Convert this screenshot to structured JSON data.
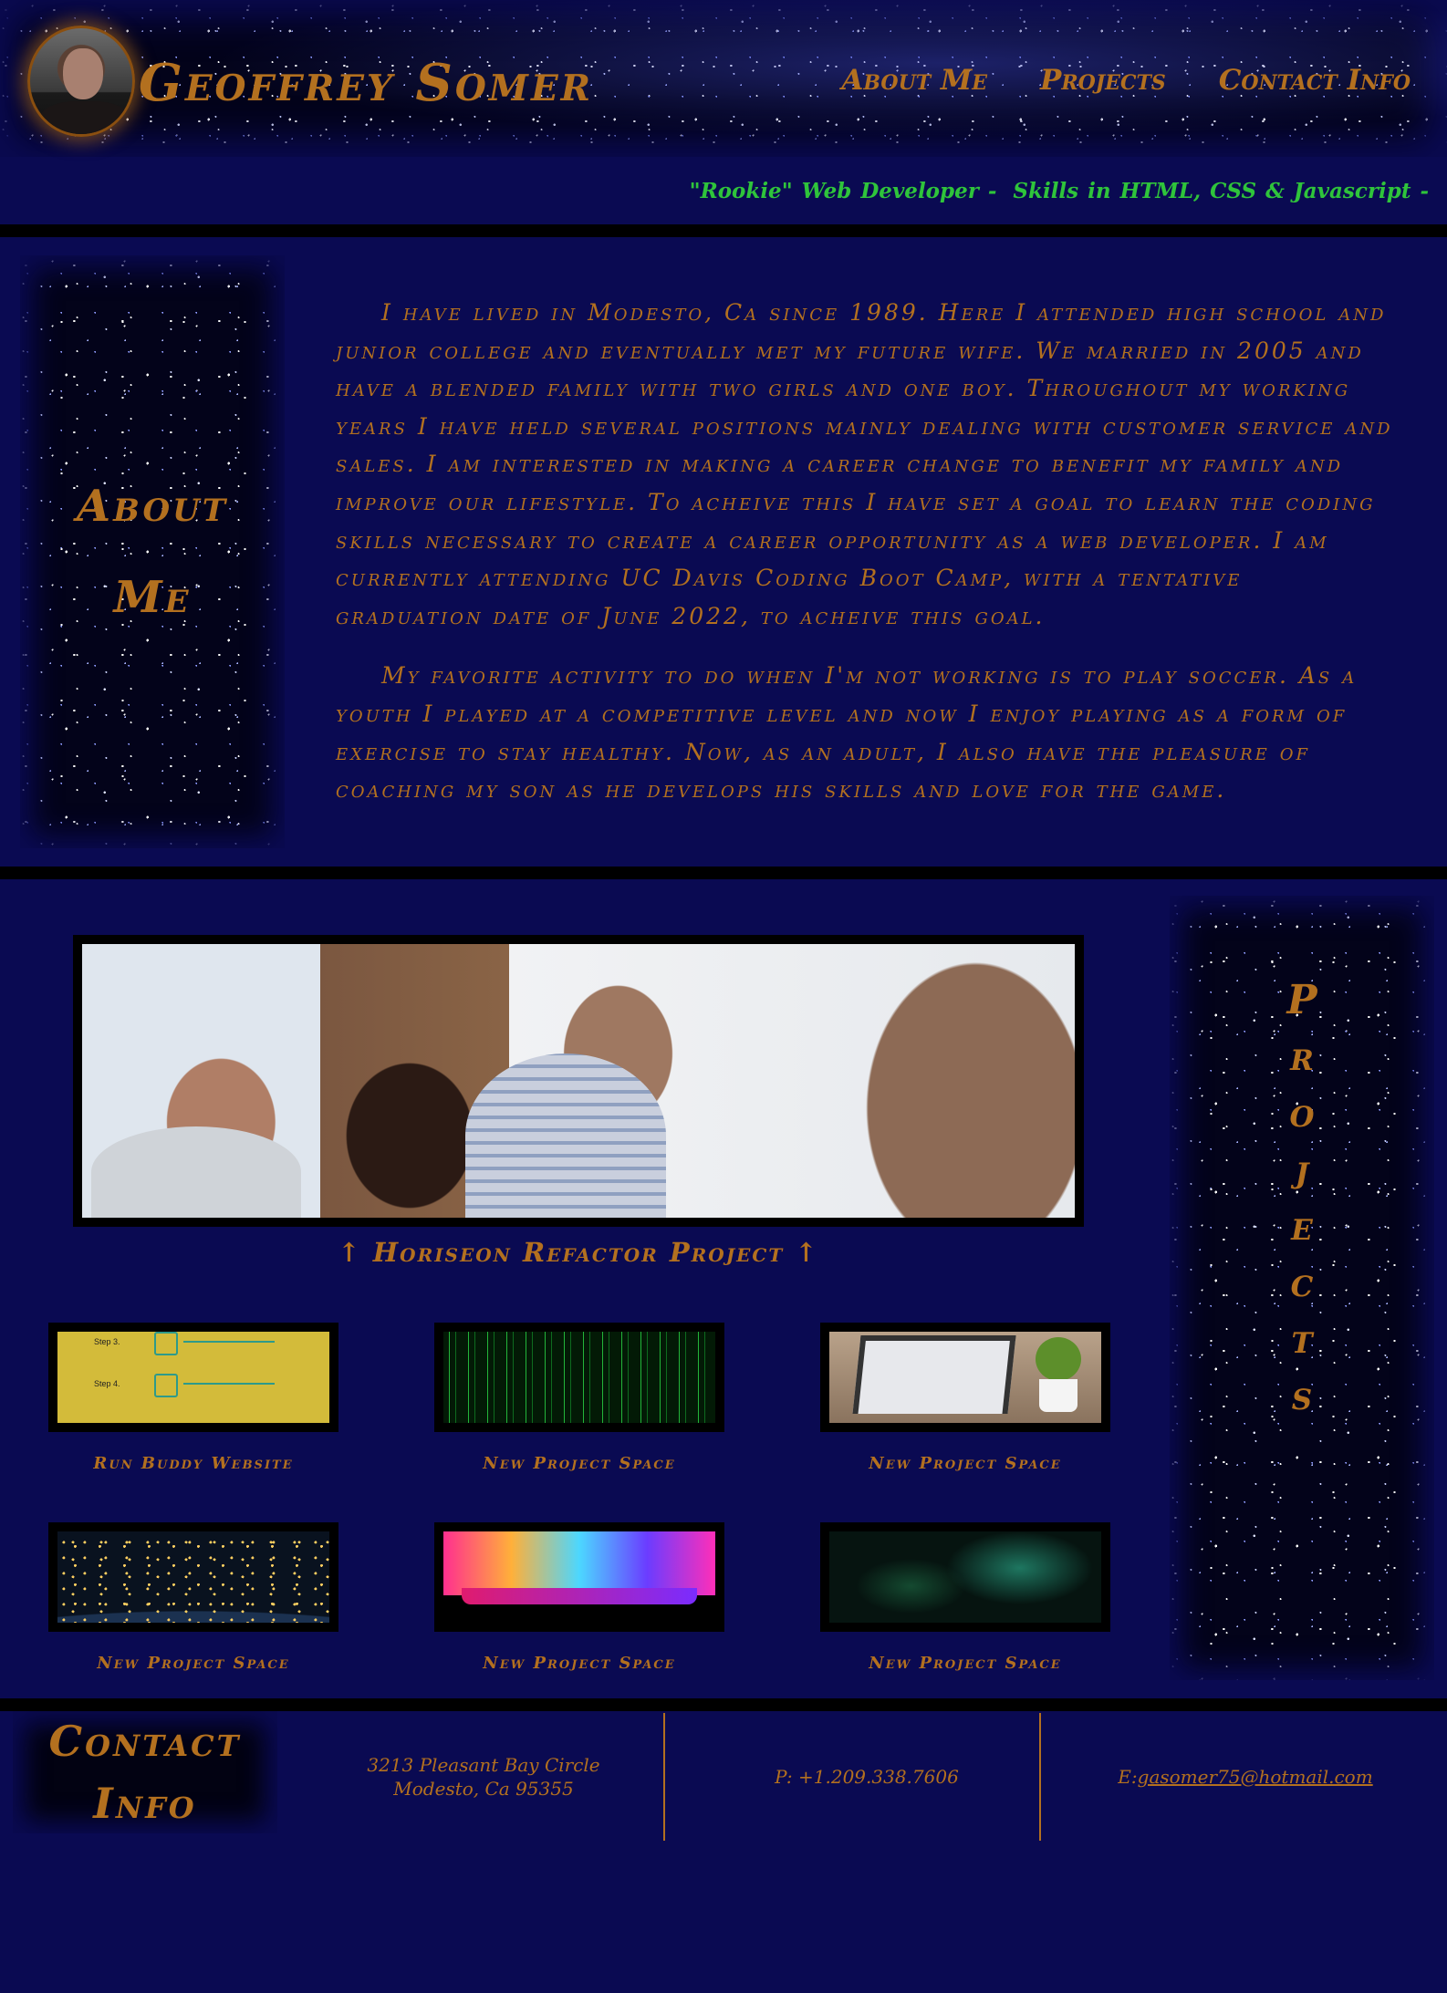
{
  "header": {
    "title": "Geoffrey Somer",
    "nav": [
      {
        "label": "About Me"
      },
      {
        "label": "Projects"
      },
      {
        "label": "Contact Info"
      }
    ],
    "tagline": {
      "role": "\"Rookie\" Web Developer -",
      "skills": "Skills in HTML, CSS & Javascript -"
    }
  },
  "about": {
    "heading_line1": "About",
    "heading_line2": "Me",
    "paragraphs": [
      "I have lived in Modesto, Ca since 1989. Here I attended high school and junior college and eventually met my future wife. We married in 2005 and have a blended family with two girls and one boy. Throughout my working years I have held several positions mainly dealing with customer service and sales. I am interested in making a career change to benefit my family and improve our lifestyle. To acheive this I have set a goal to learn the coding skills necessary to create a career opportunity as a web developer. I am currently attending UC Davis Coding Boot Camp, with a tentative graduation date of June 2022, to acheive this goal.",
      "My favorite activity to do when I'm not working is to play soccer. As a youth I played at a competitive level and now I enjoy playing as a form of exercise to stay healthy. Now, as an adult, I also have the pleasure of coaching my son as he develops his skills and love for the game."
    ]
  },
  "projects": {
    "heading_letters": [
      "P",
      "r",
      "o",
      "j",
      "e",
      "c",
      "t",
      "s"
    ],
    "featured_caption": "↑ Horiseon Refactor Project ↑",
    "items": [
      {
        "label": "Run Buddy Website",
        "image": "run-buddy-screenshot"
      },
      {
        "label": "New Project Space",
        "image": "matrix-code"
      },
      {
        "label": "New Project Space",
        "image": "laptop-desk"
      },
      {
        "label": "New Project Space",
        "image": "earth-night"
      },
      {
        "label": "New Project Space",
        "image": "rainbow-keyboard"
      },
      {
        "label": "New Project Space",
        "image": "green-nebula"
      }
    ],
    "runbuddy_steps": [
      "Step 3.",
      "Step 4."
    ]
  },
  "contact": {
    "heading_line1": "Contact",
    "heading_line2": "Info",
    "address_line1": "3213 Pleasant Bay Circle",
    "address_line2": "Modesto, Ca 95355",
    "phone": "P: +1.209.338.7606",
    "email_prefix": "E:",
    "email": "gasomer75@hotmail.com"
  },
  "colors": {
    "background": "#0a0a52",
    "accent": "#b3701f",
    "tagline": "#2fc43b",
    "divider": "#000000"
  }
}
